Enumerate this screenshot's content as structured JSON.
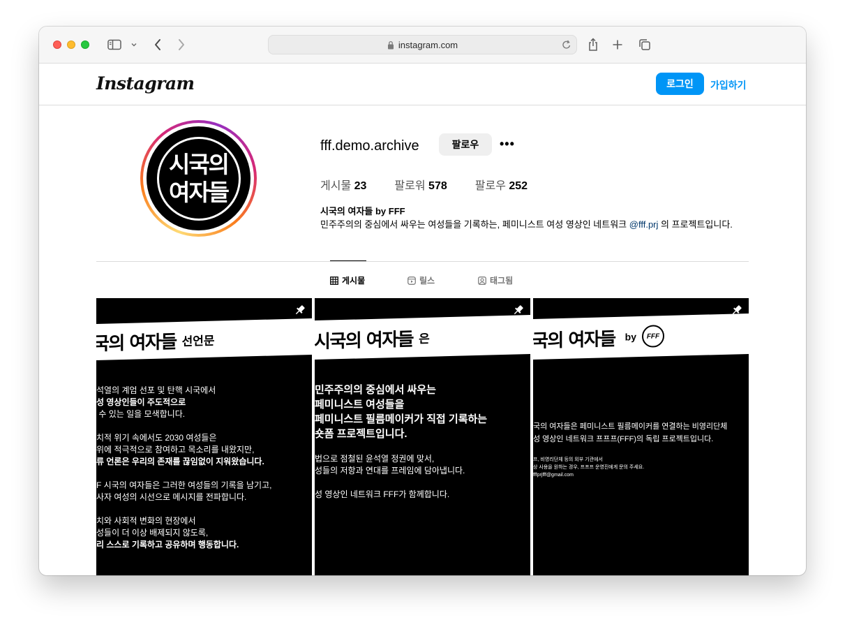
{
  "browser": {
    "url": "instagram.com"
  },
  "header": {
    "logo": "Instagram",
    "login_label": "로그인",
    "signup_label": "가입하기"
  },
  "profile": {
    "avatar_line1": "시국의",
    "avatar_line2": "여자들",
    "username": "fff.demo.archive",
    "follow_label": "팔로우",
    "more_label": "•••",
    "stats": {
      "posts_label": "게시물",
      "posts_count": "23",
      "followers_label": "팔로워",
      "followers_count": "578",
      "following_label": "팔로우",
      "following_count": "252"
    },
    "bio_name": "시국의 여자들 by FFF",
    "bio_text_before": "민주주의의 중심에서 싸우는 여성들을 기록하는, 페미니스트 여성 영상인 네트워크 ",
    "bio_mention": "@fff.prj",
    "bio_text_after": " 의 프로젝트입니다."
  },
  "tabs": [
    {
      "label": "게시물",
      "icon": "grid-icon",
      "active": true
    },
    {
      "label": "릴스",
      "icon": "reels-icon",
      "active": false
    },
    {
      "label": "태그됨",
      "icon": "tagged-icon",
      "active": false
    }
  ],
  "posts": [
    {
      "banner_big": "국의 여자들",
      "banner_small": "선언문",
      "lines": [
        {
          "text": "석열의 계엄 선포 및 탄핵 시국에서",
          "bold": false
        },
        {
          "text": "성 영상인들이 주도적으로",
          "bold": false
        },
        {
          "text": " 수 있는 일을 모색합니다.",
          "bold": false
        },
        {
          "text": "",
          "bold": false
        },
        {
          "text": "치적 위기 속에서도 2030 여성들은",
          "bold": false
        },
        {
          "text": "위에 적극적으로 참여하고 목소리를 내왔지만,",
          "bold": false
        },
        {
          "text": "류 언론은 우리의 존재를 끊임없이 지워왔습니다.",
          "bold": true
        },
        {
          "text": "",
          "bold": false
        },
        {
          "text": "F 시국의 여자들은 그러한 여성들의 기록을 남기고,",
          "bold": false
        },
        {
          "text": "사자 여성의 시선으로 메시지를 전파합니다.",
          "bold": false
        },
        {
          "text": "",
          "bold": false
        },
        {
          "text": "치와 사회적 변화의 현장에서",
          "bold": false
        },
        {
          "text": "성들이 더 이상 배제되지 않도록,",
          "bold": false
        },
        {
          "text": "리 스스로 기록하고 공유하며 행동합니다.",
          "bold": true
        }
      ]
    },
    {
      "banner_big": "시국의 여자들",
      "banner_small": "은",
      "big_lines": [
        "민주주의의 중심에서 싸우는",
        "페미니스트 여성들을",
        "페미니스트 필름메이커가 직접 기록하는",
        "숏폼 프로젝트입니다."
      ],
      "lines": [
        "법으로 점철된 윤석열 정권에 맞서,",
        "성들의 저항과 연대를 프레임에 담아냅니다.",
        "",
        "성 영상인 네트워크 FFF가 함께합니다."
      ]
    },
    {
      "banner_big": "국의 여자들",
      "banner_small": "by",
      "logo_mark": "FFF",
      "lines": [
        "국의 여자들은 페미니스트 필름메이커를 연결하는 비영리단체",
        "성 영상인 네트워크 프프프(FFF)의 독립 프로젝트입니다."
      ],
      "tiny_lines": [
        "프, 비영리단체 등의 외부 기관에서",
        "상 사용을 원하는 경우, 프프프 운영진에게 문의 주세요.",
        "fffprjfff@gmail.com"
      ]
    }
  ]
}
